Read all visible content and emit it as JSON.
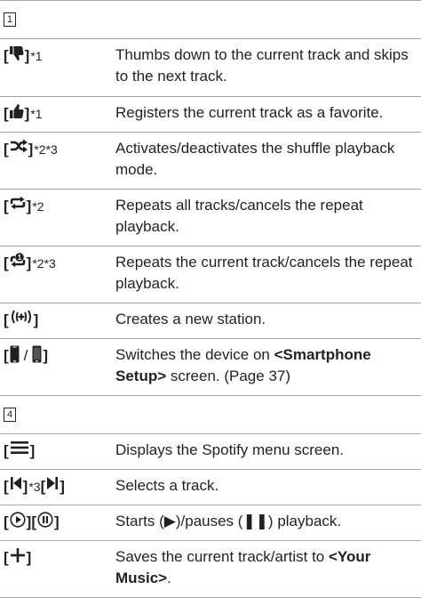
{
  "section1": {
    "number": "1",
    "rows": [
      {
        "icon": "thumbs-down-icon",
        "suffix": "*1",
        "desc": "Thumbs down to the current track and skips to the next track."
      },
      {
        "icon": "thumbs-up-icon",
        "suffix": "*1",
        "desc": "Registers the current track as a favorite."
      },
      {
        "icon": "shuffle-icon",
        "suffix": "*2*3",
        "desc": "Activates/deactivates the shuffle playback mode."
      },
      {
        "icon": "repeat-all-icon",
        "suffix": "*2",
        "desc": "Repeats all tracks/cancels the repeat playback."
      },
      {
        "icon": "repeat-one-icon",
        "suffix": "*2*3",
        "desc": "Repeats the current track/cancels the repeat playback."
      },
      {
        "icon": "radio-station-icon",
        "suffix": "",
        "desc": "Creates a new station."
      },
      {
        "icon": "smartphone-icon",
        "suffix": "",
        "desc_pre": "Switches the device on ",
        "desc_bold": "<Smartphone Setup>",
        "desc_post": " screen. (Page 37)"
      }
    ]
  },
  "section4": {
    "number": "4",
    "rows": [
      {
        "icon": "menu-icon",
        "suffix": "",
        "desc": "Displays the Spotify menu screen."
      },
      {
        "icon": "previous-next-icon",
        "mid": "*3",
        "desc": "Selects a track."
      },
      {
        "icon": "play-pause-icon",
        "desc": "Starts (▶)/pauses (❚❚) playback."
      },
      {
        "icon": "add-icon",
        "desc_pre": "Saves the current track/artist to ",
        "desc_bold": "<Your Music>",
        "desc_post": "."
      }
    ]
  },
  "labels": {
    "slash": "/"
  }
}
